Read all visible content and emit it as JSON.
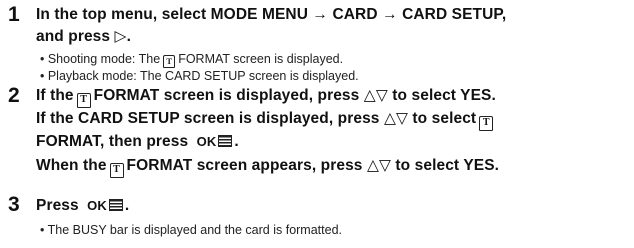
{
  "steps": [
    {
      "number": "1",
      "line1_a": "In the top menu, select MODE MENU",
      "arrow1": "→",
      "line1_b": "CARD",
      "arrow2": "→",
      "line1_c": "CARD SETUP,",
      "line2_a": "and press",
      "line2_sym": "▷",
      "line2_b": ".",
      "bullets": [
        {
          "prefix": "• Shooting mode: The",
          "suffix": "FORMAT screen is displayed."
        },
        {
          "text": "• Playback mode: The CARD SETUP screen is displayed."
        }
      ]
    },
    {
      "number": "2",
      "l1_a": "If the",
      "l1_b": "FORMAT screen is displayed, press",
      "l1_sym": "△▽",
      "l1_c": "to select YES.",
      "l2_a": "If the CARD SETUP screen is displayed, press",
      "l2_sym": "△▽",
      "l2_b": "to select",
      "l3_a": "FORMAT, then press",
      "l3_ok": "OK",
      "l3_b": ".",
      "l4_a": "When the",
      "l4_b": "FORMAT screen appears, press",
      "l4_sym": "△▽",
      "l4_c": "to select YES."
    },
    {
      "number": "3",
      "l1_a": "Press",
      "l1_ok": "OK",
      "l1_b": ".",
      "bullet": "• The BUSY bar is displayed and the card is formatted."
    }
  ],
  "icons": [
    "card-icon",
    "menu-ok-icon"
  ]
}
